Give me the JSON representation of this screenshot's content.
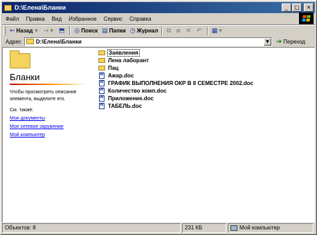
{
  "window": {
    "title": "D:\\Елена\\Бланки"
  },
  "title_buttons": {
    "minimize": "_",
    "maximize": "□",
    "close": "×"
  },
  "menu": [
    "Файл",
    "Правка",
    "Вид",
    "Избранное",
    "Сервис",
    "Справка"
  ],
  "toolbar": {
    "back_label": "Назад",
    "search_label": "Поиск",
    "folders_label": "Папки",
    "journal_label": "Журнал"
  },
  "address": {
    "label": "Адрес",
    "value": "D:\\Елена\\Бланки",
    "go_label": "Переход"
  },
  "left_pane": {
    "title": "Бланки",
    "description": "Чтобы просмотреть описание элемента, выделите его.",
    "see_also": "См. также:",
    "links": [
      "Мои документы",
      "Мое сетевое окружение",
      "Мой компьютер"
    ]
  },
  "files": [
    {
      "name": "Заявления",
      "type": "folder",
      "selected": true
    },
    {
      "name": "Лена лаборант",
      "type": "folder"
    },
    {
      "name": "Пац",
      "type": "folder"
    },
    {
      "name": "Ажар.doc",
      "type": "doc"
    },
    {
      "name": "ГРАФИК ВЫПОЛНЕНИЯ ОКР В II  СЕМЕСТРЕ 2002.doc",
      "type": "doc"
    },
    {
      "name": "Количество комп.doc",
      "type": "doc"
    },
    {
      "name": "Приложение.doc",
      "type": "doc"
    },
    {
      "name": "ТАБЕЛЬ.doc",
      "type": "doc"
    }
  ],
  "status": {
    "objects": "Объектов: 8",
    "size": "231 КБ",
    "location": "Мой компьютер"
  },
  "colors": {
    "titlebar_start": "#0a246a",
    "titlebar_end": "#3a6ea5",
    "folder": "#f4d35e",
    "link": "#0000ee"
  }
}
